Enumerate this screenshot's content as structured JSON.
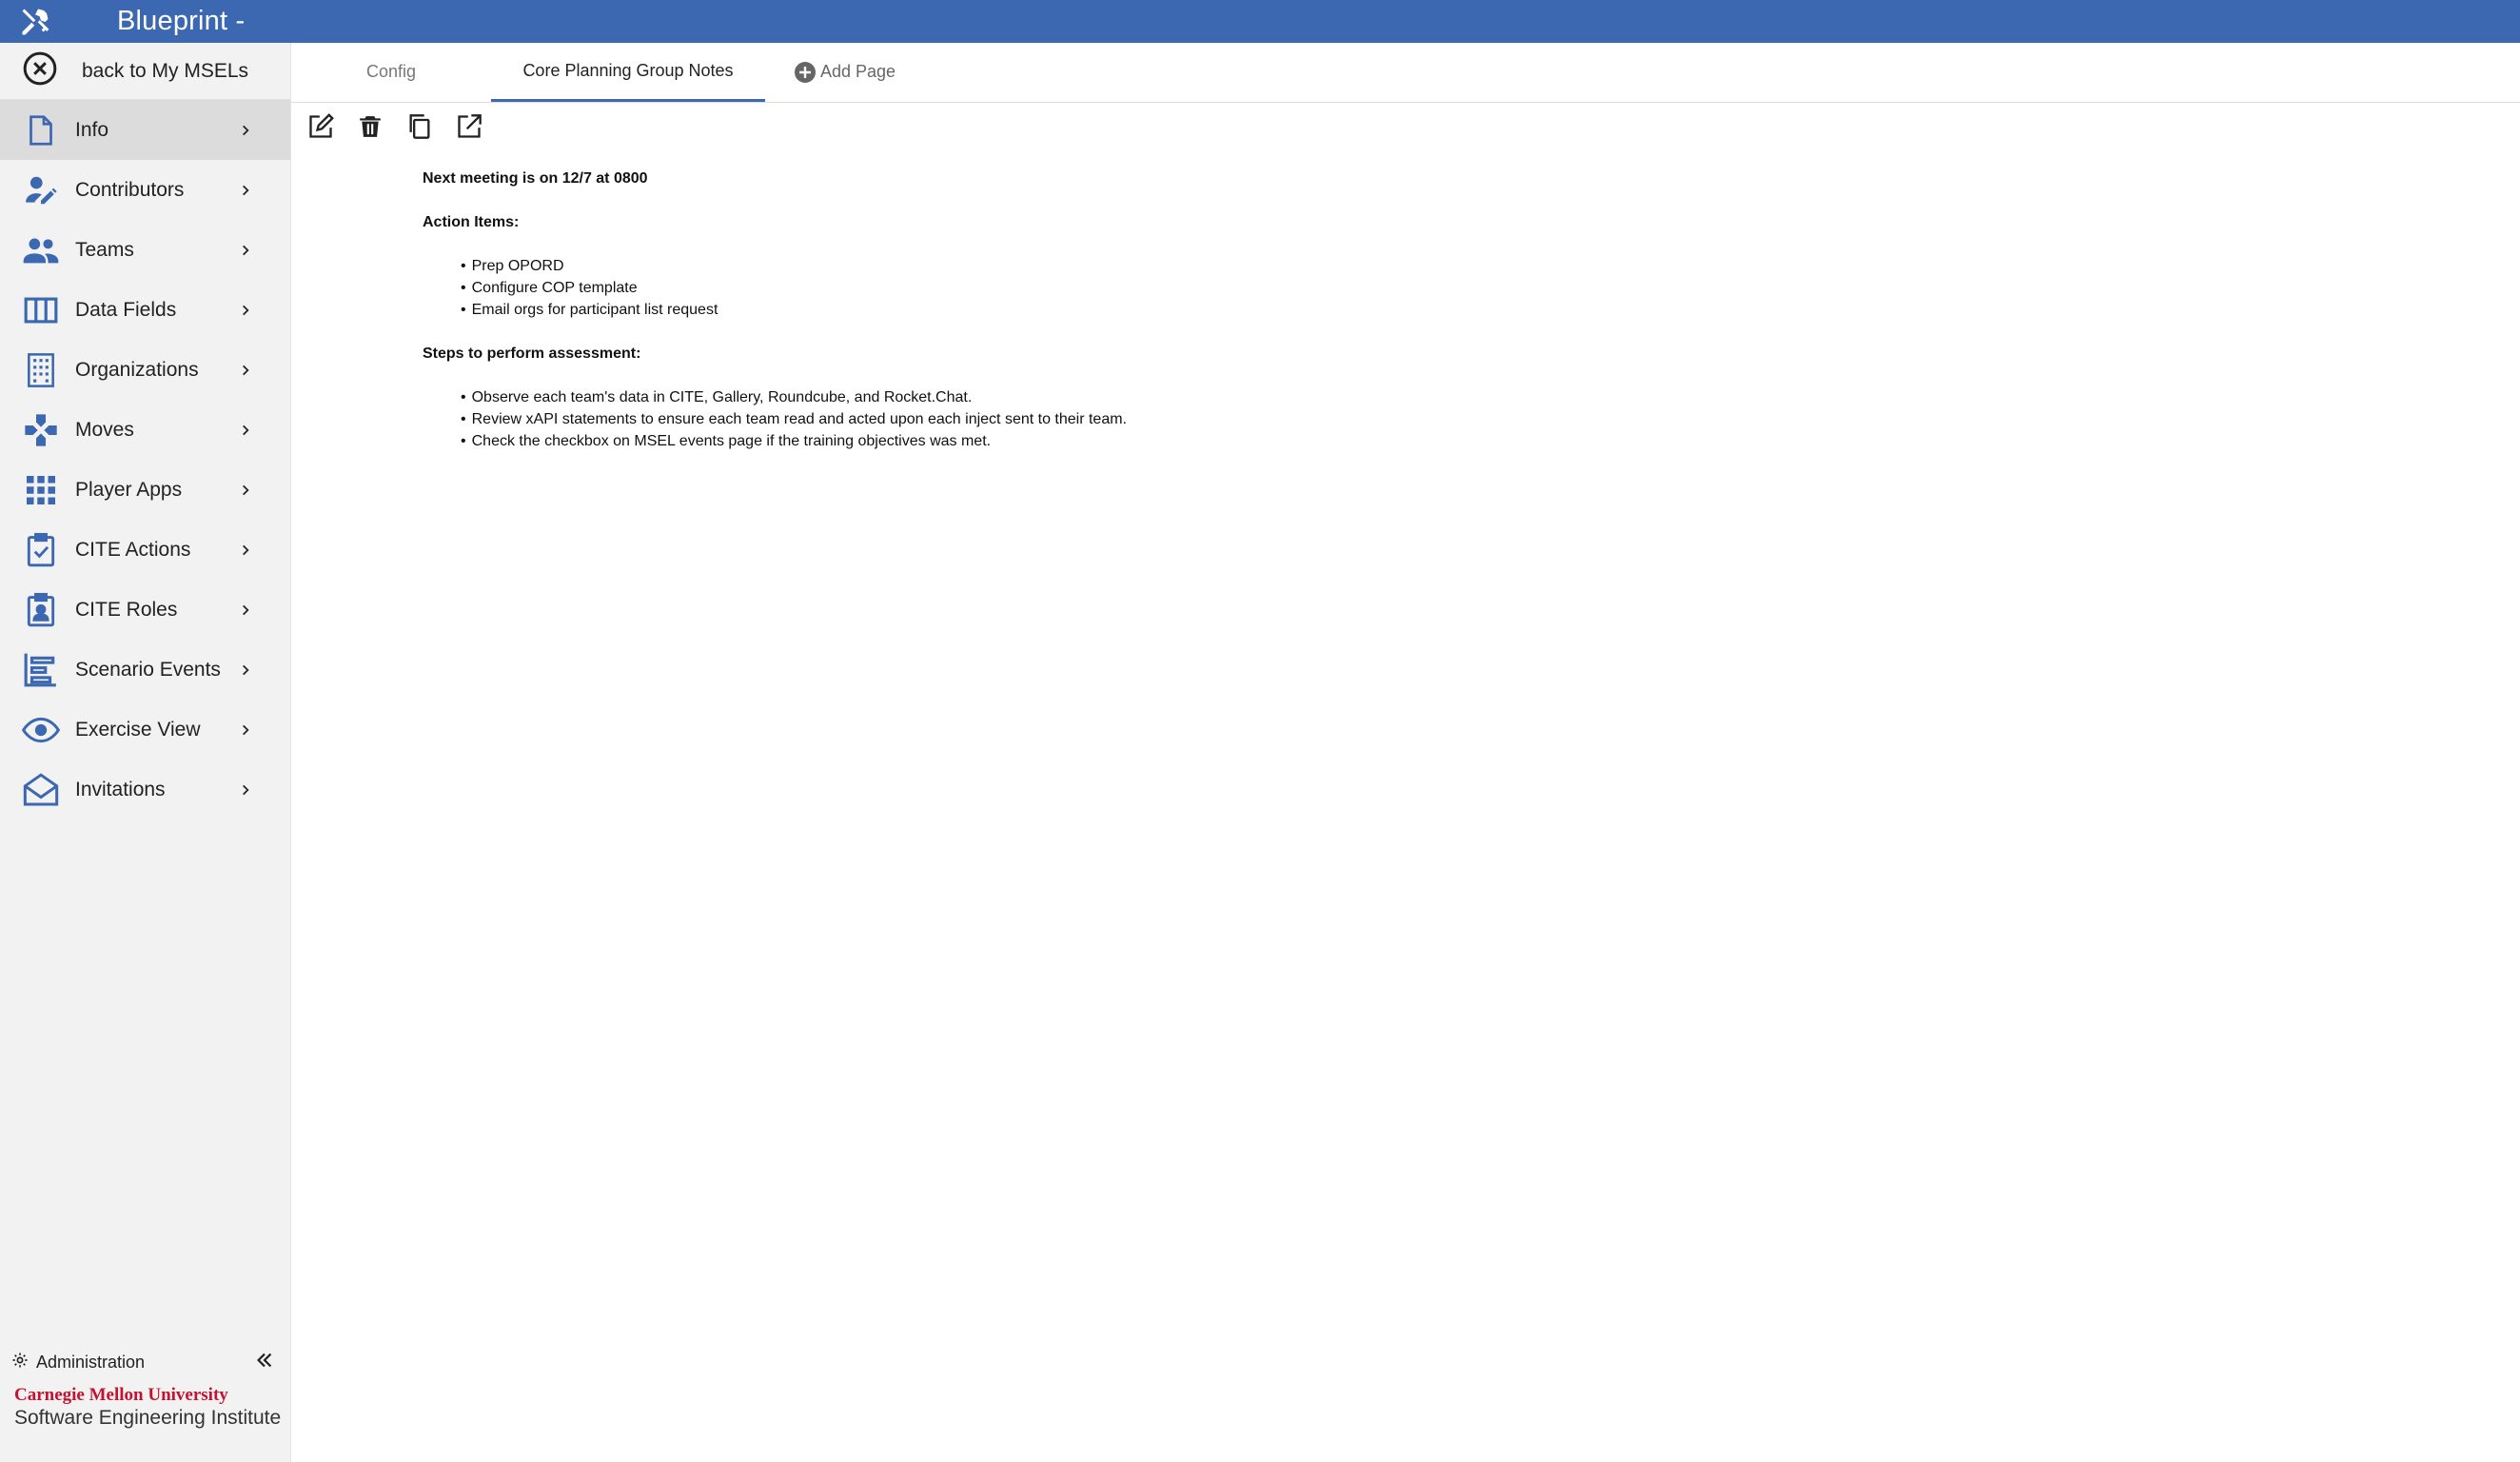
{
  "app": {
    "title": "Blueprint -"
  },
  "sidebar": {
    "back_label": "back to My MSELs",
    "items": [
      {
        "label": "Info",
        "icon": "file-icon",
        "active": true
      },
      {
        "label": "Contributors",
        "icon": "person-edit-icon"
      },
      {
        "label": "Teams",
        "icon": "people-icon"
      },
      {
        "label": "Data Fields",
        "icon": "columns-icon"
      },
      {
        "label": "Organizations",
        "icon": "building-icon"
      },
      {
        "label": "Moves",
        "icon": "gamepad-icon"
      },
      {
        "label": "Player Apps",
        "icon": "apps-grid-icon"
      },
      {
        "label": "CITE Actions",
        "icon": "clipboard-check-icon"
      },
      {
        "label": "CITE Roles",
        "icon": "badge-icon"
      },
      {
        "label": "Scenario Events",
        "icon": "timeline-icon"
      },
      {
        "label": "Exercise View",
        "icon": "eye-icon"
      },
      {
        "label": "Invitations",
        "icon": "envelope-open-icon"
      }
    ],
    "admin_label": "Administration",
    "footer_logo": {
      "line1": "Carnegie Mellon University",
      "line2": "Software Engineering Institute"
    }
  },
  "tabs": [
    {
      "label": "Config",
      "active": false
    },
    {
      "label": "Core Planning Group Notes",
      "active": true
    }
  ],
  "add_page_label": "Add Page",
  "notes": {
    "meeting": "Next meeting is on 12/7 at 0800",
    "action_heading": "Action Items:",
    "action_items": [
      "Prep OPORD",
      "Configure COP template",
      "Email orgs for participant list request"
    ],
    "steps_heading": "Steps to perform assessment:",
    "steps": [
      "Observe each team's data in CITE, Gallery, Roundcube, and Rocket.Chat.",
      "Review xAPI statements to ensure each team read and acted upon each inject sent to their team.",
      "Check the checkbox on MSEL events page if the training objectives was met."
    ]
  },
  "colors": {
    "brand": "#3c67b1",
    "sidebar_bg": "#f2f2f2",
    "active_bg": "#dcdcdc",
    "cmu_red": "#c41230"
  }
}
